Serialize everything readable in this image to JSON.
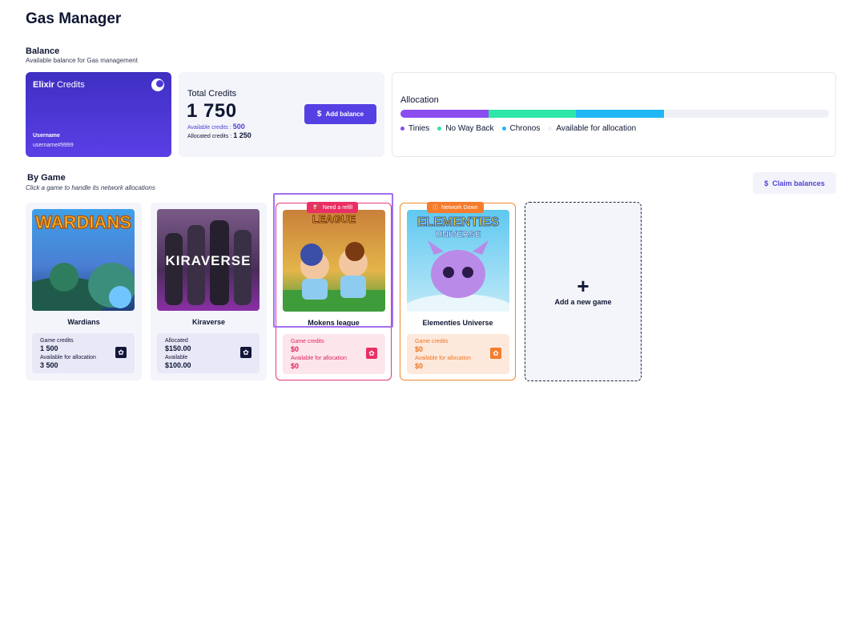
{
  "page": {
    "title": "Gas Manager"
  },
  "balance": {
    "title": "Balance",
    "subtitle": "Available balance for Gas management",
    "elixir": {
      "brand": "Elixir",
      "brand_suffix": "Credits",
      "username_label": "Username",
      "username": "username#9999"
    },
    "total": {
      "label": "Total Credits",
      "value": "1 750",
      "available_label": "Available credits :",
      "available_value": "500",
      "allocated_label": "Allocated credits :",
      "allocated_value": "1 250",
      "add_button": "Add balance",
      "add_icon": "dollar-icon"
    },
    "allocation": {
      "title": "Allocation",
      "segments": [
        {
          "name": "Tinies",
          "color": "#8b4cf0",
          "fraction": 0.205
        },
        {
          "name": "No Way Back",
          "color": "#2ee6a8",
          "fraction": 0.205
        },
        {
          "name": "Chronos",
          "color": "#1fb7f5",
          "fraction": 0.205
        },
        {
          "name": "Available for allocation",
          "color": "#eef0f6",
          "fraction": 0.385
        }
      ]
    }
  },
  "by_game": {
    "title": "By Game",
    "subtitle": "Click a game to handle its network allocations",
    "claim_button": "Claim balances",
    "claim_icon": "dollar-icon",
    "games": [
      {
        "name": "Wardians",
        "line1_label": "Game credits",
        "line1_value": "1 500",
        "line2_label": "Available for allocation",
        "line2_value": "3 500",
        "status": ""
      },
      {
        "name": "Kiraverse",
        "line1_label": "Allocated",
        "line1_value": "$150.00",
        "line2_label": "Available",
        "line2_value": "$100.00",
        "status": ""
      },
      {
        "name": "Mokens league",
        "line1_label": "Game credits",
        "line1_value": "$0",
        "line2_label": "Available for allocation",
        "line2_value": "$0",
        "status": "Need a refill"
      },
      {
        "name": "Elementies Universe",
        "line1_label": "Game credits",
        "line1_value": "$0",
        "line2_label": "Available for allocation",
        "line2_value": "$0",
        "status": "Network Down"
      }
    ],
    "add_game_label": "Add a new game"
  },
  "colors": {
    "accent": "#5540e4",
    "refill": "#ea2f64",
    "network_down": "#f47c2c",
    "dark": "#0f1633"
  }
}
